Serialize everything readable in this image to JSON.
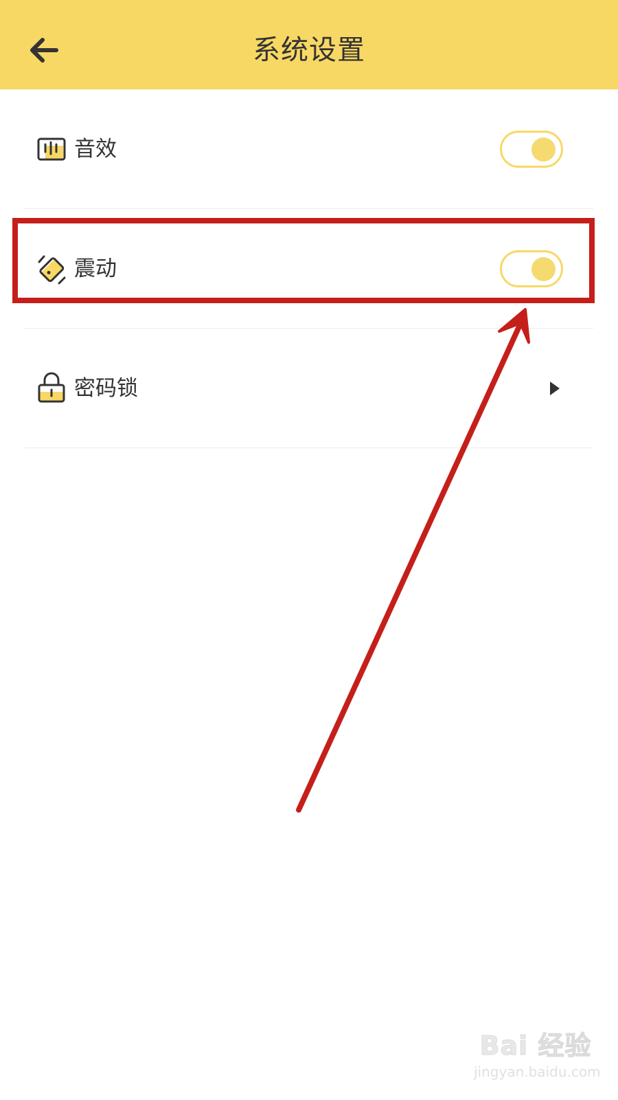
{
  "header": {
    "title": "系统设置",
    "back_icon": "arrow-left-icon",
    "background_color": "#F8D864"
  },
  "settings": {
    "items": [
      {
        "label": "音效",
        "icon": "sound-effect-icon",
        "control": "toggle",
        "enabled": true
      },
      {
        "label": "震动",
        "icon": "vibration-icon",
        "control": "toggle",
        "enabled": true
      },
      {
        "label": "密码锁",
        "icon": "lock-icon",
        "control": "chevron"
      }
    ]
  },
  "annotation": {
    "highlight_color": "#C51F1A",
    "highlighted_item": "震动"
  },
  "watermark": {
    "logo": "Bai 经验",
    "url": "jingyan.baidu.com"
  }
}
